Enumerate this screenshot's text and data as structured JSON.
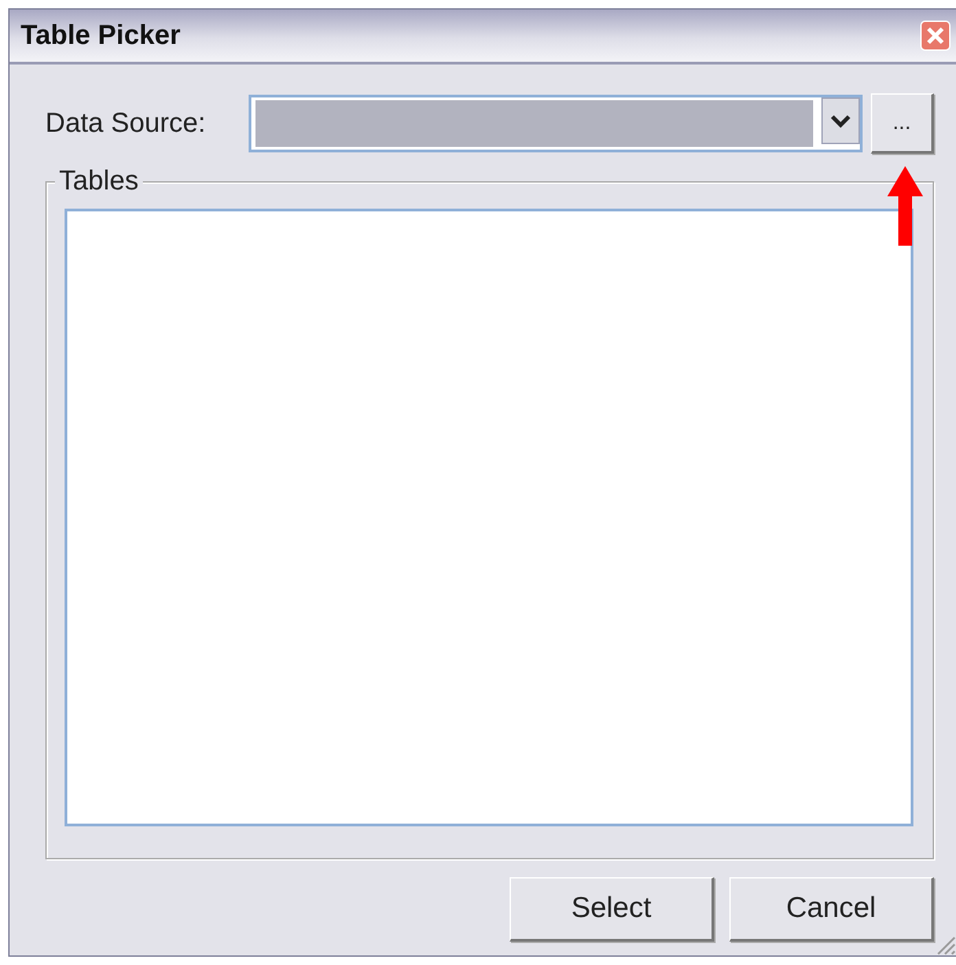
{
  "window": {
    "title": "Table Picker"
  },
  "data_source": {
    "label": "Data Source:",
    "browse_button": "..."
  },
  "tables": {
    "label": "Tables"
  },
  "buttons": [
    {
      "label": "Select"
    },
    {
      "label": "Cancel"
    }
  ]
}
